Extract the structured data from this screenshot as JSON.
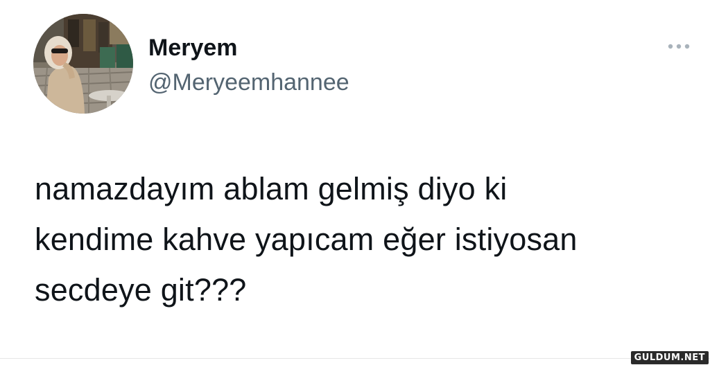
{
  "tweet": {
    "author": {
      "display_name": "Meryem",
      "handle": "@Meryeemhannee",
      "avatar_icon": "profile-photo"
    },
    "more_icon": "more-horizontal-icon",
    "text_lines": [
      "namazdayım ablam gelmiş diyo ki",
      "kendime kahve yapıcam eğer istiyosan",
      "secdeye git???"
    ]
  },
  "watermark": {
    "text": "GULDUM.NET"
  },
  "colors": {
    "name": "#0f1419",
    "handle": "#536471",
    "more_dots": "#a9b3bb",
    "background": "#ffffff"
  }
}
